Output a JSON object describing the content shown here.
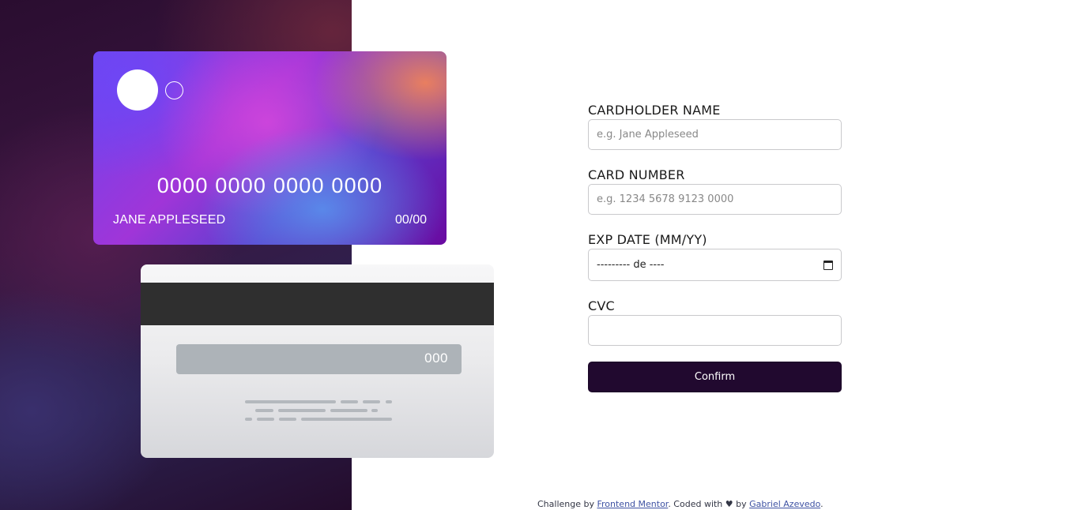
{
  "card_front": {
    "number": "0000 0000 0000 0000",
    "name": "JANE APPLESEED",
    "exp": "00/00"
  },
  "card_back": {
    "cvc": "000"
  },
  "form": {
    "name_label": "CARDHOLDER NAME",
    "name_placeholder": "e.g. Jane Appleseed",
    "number_label": "CARD NUMBER",
    "number_placeholder": "e.g. 1234 5678 9123 0000",
    "exp_label": "EXP DATE (MM/YY)",
    "exp_value": "--------- de ----",
    "cvc_label": "CVC",
    "confirm_label": "Confirm"
  },
  "footer": {
    "prefix": "Challenge by ",
    "link1": "Frontend Mentor",
    "middle": ". Coded with ♥ by ",
    "link2": "Gabriel Azevedo",
    "suffix": "."
  }
}
